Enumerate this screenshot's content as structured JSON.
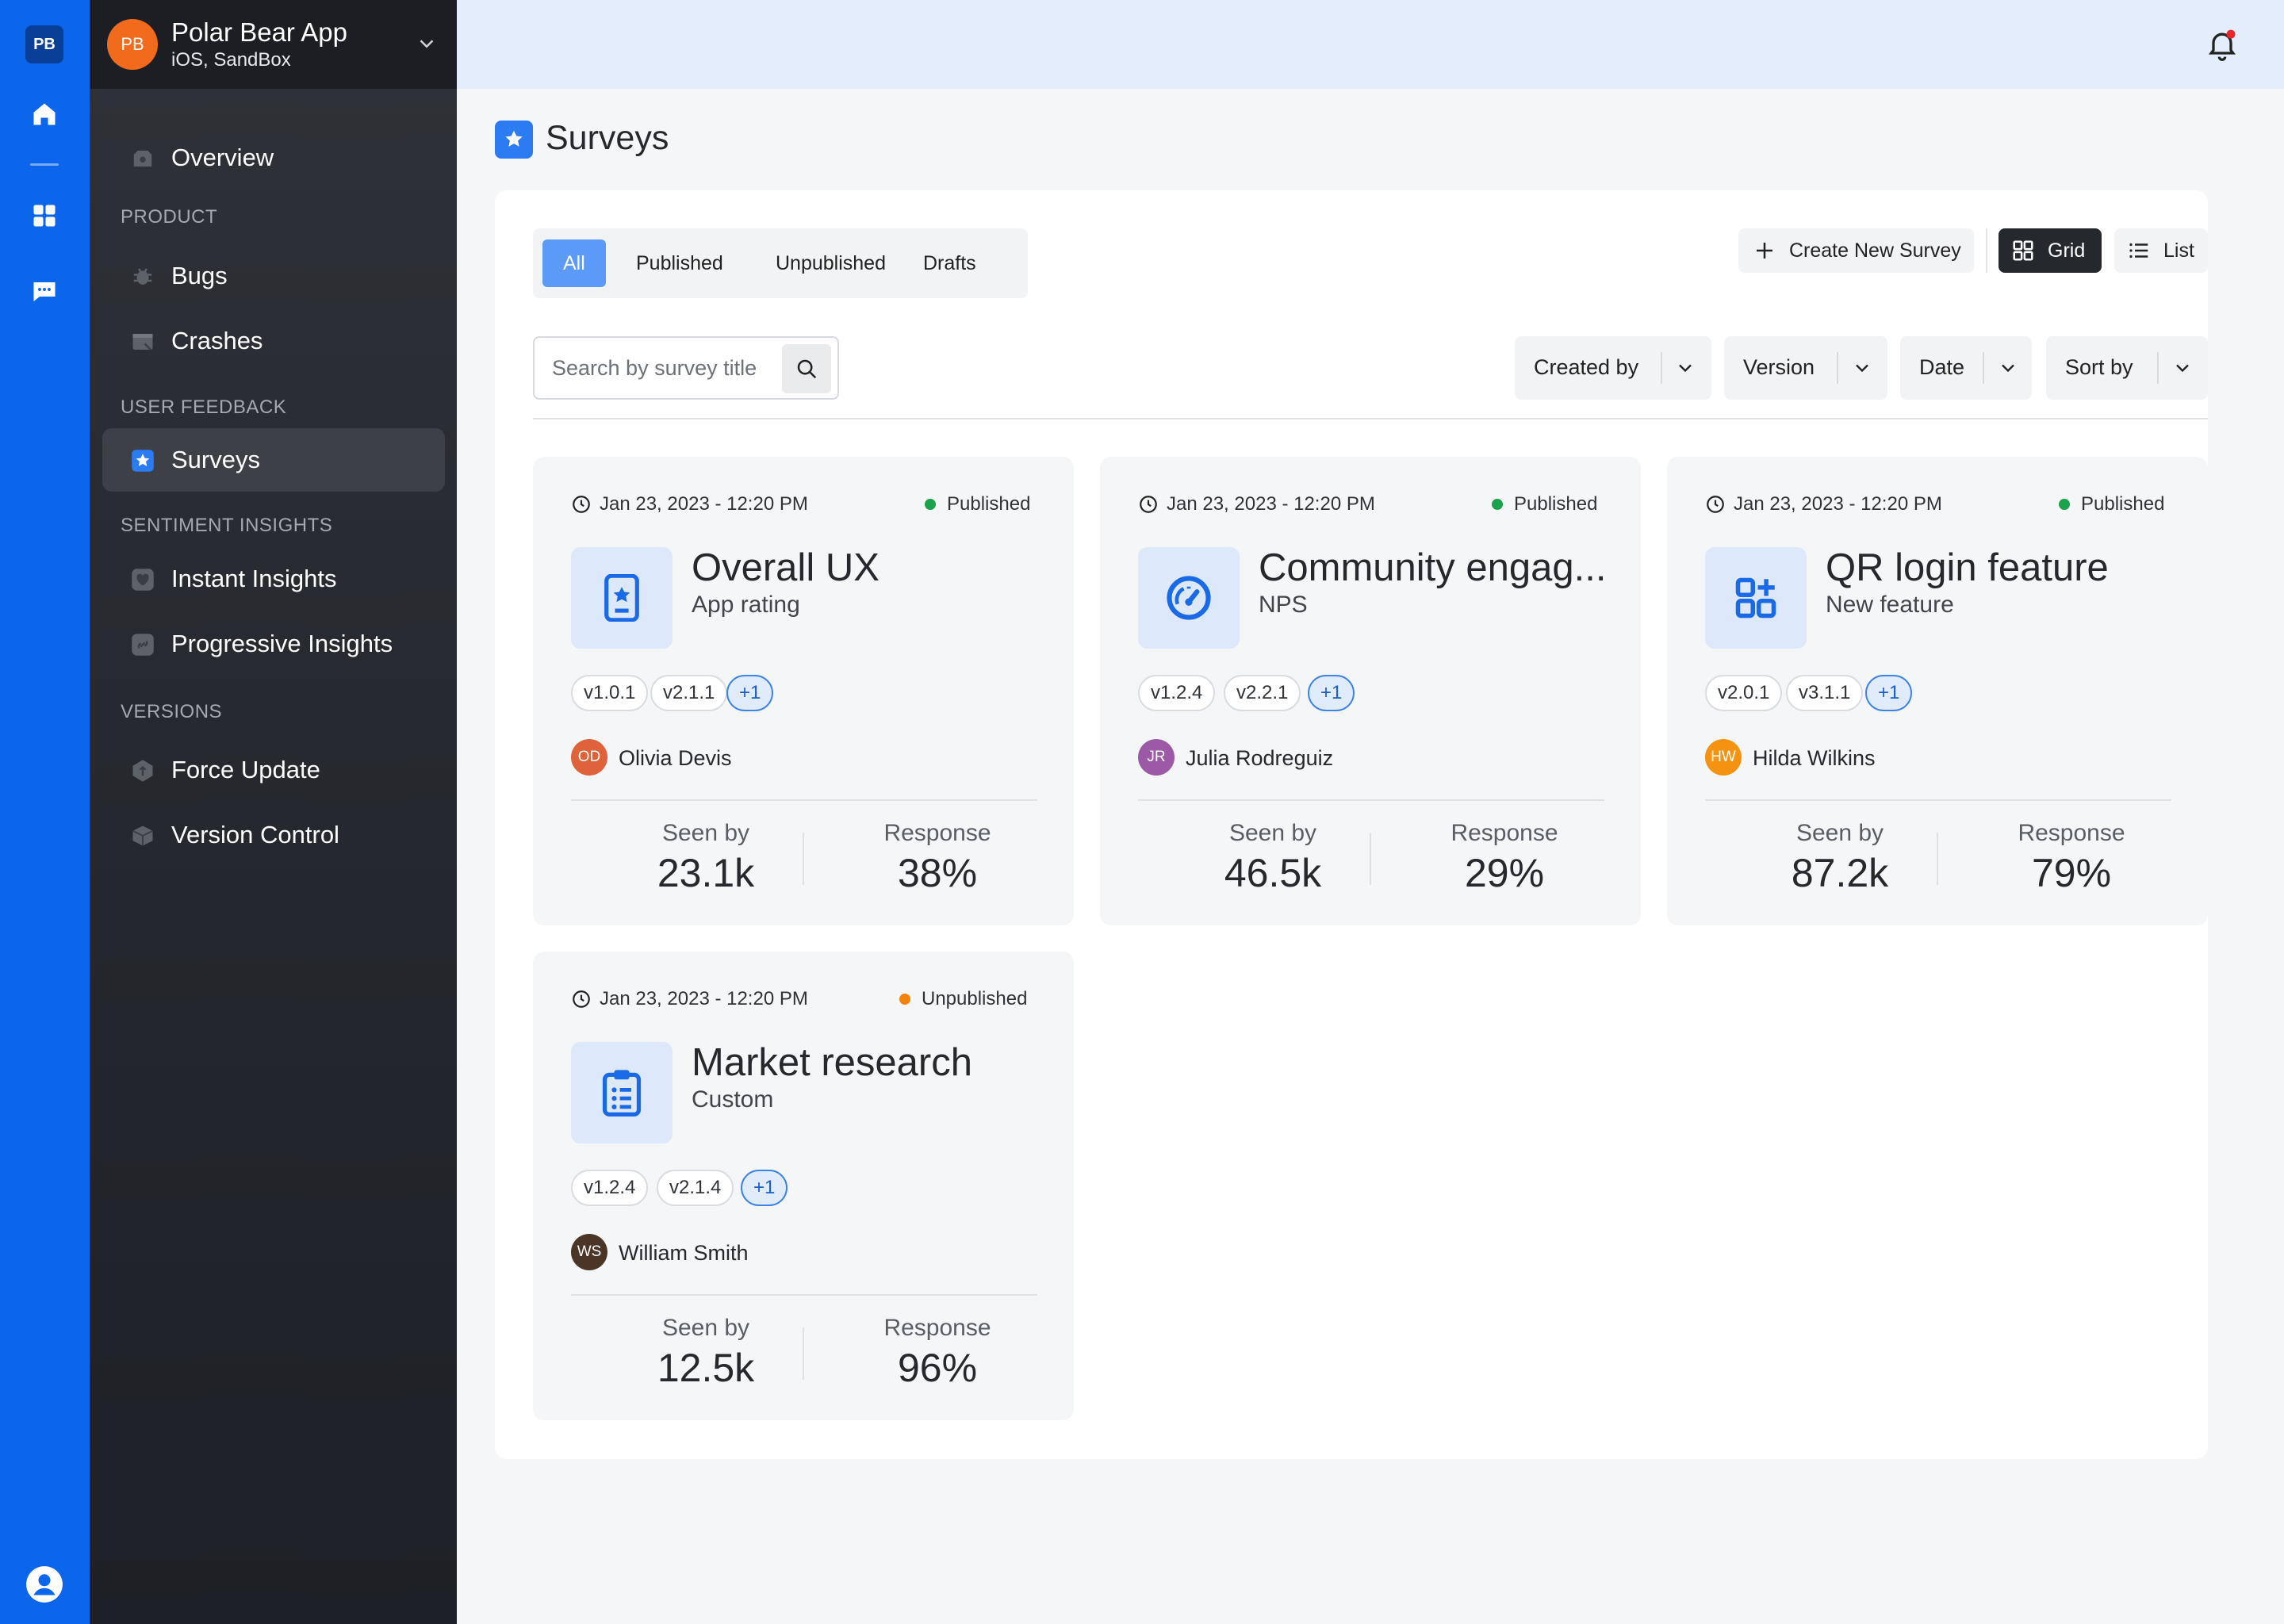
{
  "rail": {
    "logo": "PB",
    "icons": [
      "home-icon",
      "dashboard-icon",
      "chat-icon",
      "user-icon"
    ]
  },
  "app": {
    "avatar": "PB",
    "name": "Polar Bear App",
    "env": "iOS, SandBox"
  },
  "sidebar": {
    "overview": "Overview",
    "sections": {
      "product": "PRODUCT",
      "user_feedback": "USER FEEDBACK",
      "sentiment": "SENTIMENT INSIGHTS",
      "versions": "VERSIONS"
    },
    "items": {
      "bugs": "Bugs",
      "crashes": "Crashes",
      "surveys": "Surveys",
      "instant": "Instant Insights",
      "progressive": "Progressive Insights",
      "force_update": "Force Update",
      "version_control": "Version Control"
    }
  },
  "page": {
    "title": "Surveys"
  },
  "tabs": {
    "all": "All",
    "published": "Published",
    "unpublished": "Unpublished",
    "drafts": "Drafts",
    "active": "all"
  },
  "toolbar": {
    "create": "Create New Survey",
    "grid": "Grid",
    "list": "List",
    "view": "grid"
  },
  "search": {
    "placeholder": "Search by survey title",
    "value": ""
  },
  "filters": {
    "created_by": "Created by",
    "version": "Version",
    "date": "Date",
    "sort_by": "Sort by"
  },
  "colors": {
    "accent": "#0b66ec",
    "published": "#1aa34a",
    "unpublished": "#f5820d"
  },
  "cards": [
    {
      "date": "Jan 23, 2023 - 12:20 PM",
      "status": "Published",
      "icon": "phone-star-icon",
      "title": "Overall UX",
      "subtitle": "App rating",
      "chips": [
        "v1.0.1",
        "v2.1.1",
        "+1"
      ],
      "owner_initials": "OD",
      "owner": "Olivia Devis",
      "owner_color": "#e0623a",
      "seen_label": "Seen by",
      "seen": "23.1k",
      "response_label": "Response",
      "response": "38%"
    },
    {
      "date": "Jan 23, 2023 - 12:20 PM",
      "status": "Published",
      "icon": "gauge-icon",
      "title": "Community engag...",
      "subtitle": "NPS",
      "chips": [
        "v1.2.4",
        "v2.2.1",
        "+1"
      ],
      "owner_initials": "JR",
      "owner": "Julia Rodreguiz",
      "owner_color": "#9b59a6",
      "seen_label": "Seen by",
      "seen": "46.5k",
      "response_label": "Response",
      "response": "29%"
    },
    {
      "date": "Jan 23, 2023 - 12:20 PM",
      "status": "Published",
      "icon": "apps-add-icon",
      "title": "QR login feature",
      "subtitle": "New feature",
      "chips": [
        "v2.0.1",
        "v3.1.1",
        "+1"
      ],
      "owner_initials": "HW",
      "owner": "Hilda Wilkins",
      "owner_color": "#f5920f",
      "seen_label": "Seen by",
      "seen": "87.2k",
      "response_label": "Response",
      "response": "79%"
    },
    {
      "date": "Jan 23, 2023 - 12:20 PM",
      "status": "Unpublished",
      "icon": "clipboard-list-icon",
      "title": "Market research",
      "subtitle": "Custom",
      "chips": [
        "v1.2.4",
        "v2.1.4",
        "+1"
      ],
      "owner_initials": "WS",
      "owner": "William Smith",
      "owner_color": "#4a3526",
      "seen_label": "Seen by",
      "seen": "12.5k",
      "response_label": "Response",
      "response": "96%"
    }
  ]
}
